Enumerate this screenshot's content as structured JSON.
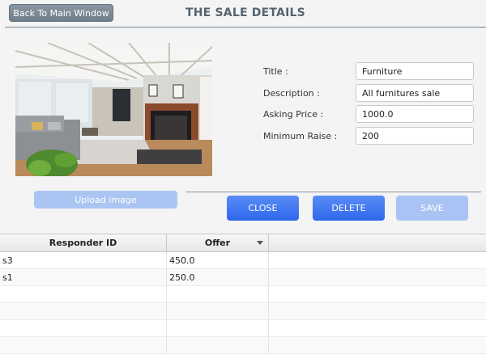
{
  "header": {
    "back_label": "Back To Main Window",
    "title": "THE SALE DETAILS"
  },
  "image": {
    "upload_label": "Upload image"
  },
  "form": {
    "title_label": "Title :",
    "title_value": "Furniture",
    "description_label": "Description :",
    "description_value": "All furnitures sale",
    "price_label": "Asking Price :",
    "price_value": "1000.0",
    "raise_label": "Minimum Raise :",
    "raise_value": "200"
  },
  "actions": {
    "close_label": "CLOSE",
    "delete_label": "DELETE",
    "save_label": "SAVE"
  },
  "table": {
    "headers": [
      "Responder ID",
      "Offer",
      ""
    ],
    "rows": [
      [
        "s3",
        "450.0",
        ""
      ],
      [
        "s1",
        "250.0",
        ""
      ]
    ]
  },
  "colors": {
    "primary_button": "#2e67ec",
    "disabled_button": "#a9c3f4",
    "back_button": "#6f7e8a"
  },
  "icons": {
    "sort": "sort-descending-icon"
  }
}
